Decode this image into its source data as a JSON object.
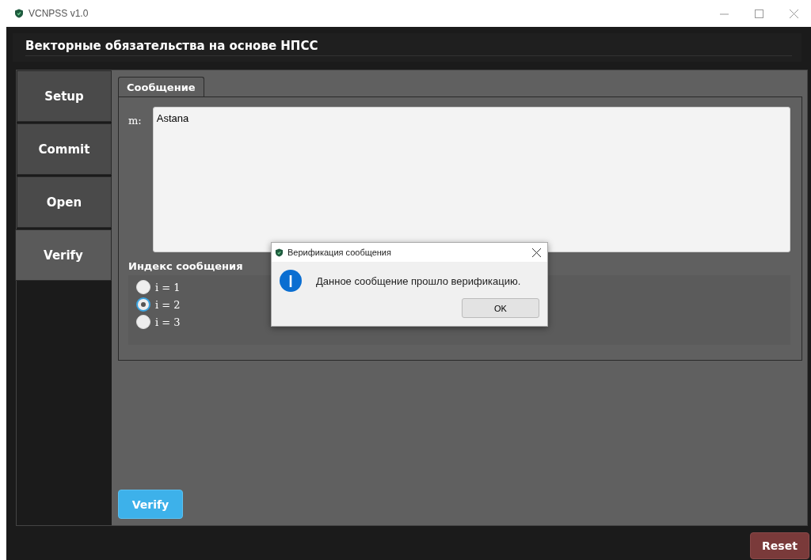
{
  "window": {
    "title": "VCNPSS v1.0"
  },
  "header": {
    "title": "Векторные обязательства на основе НПСС"
  },
  "nav": [
    {
      "label": "Setup",
      "selected": false
    },
    {
      "label": "Commit",
      "selected": false
    },
    {
      "label": "Open",
      "selected": false
    },
    {
      "label": "Verify",
      "selected": true
    }
  ],
  "tabs": [
    {
      "label": "Сообщение",
      "selected": true
    }
  ],
  "message": {
    "label": "m:",
    "value": "Astana"
  },
  "index": {
    "title": "Индекс сообщения",
    "options": [
      {
        "label": "i = 1",
        "selected": false
      },
      {
        "label": "i = 2",
        "selected": true
      },
      {
        "label": "i = 3",
        "selected": false
      }
    ]
  },
  "verify_button": "Verify",
  "reset_button": "Reset",
  "dialog": {
    "title": "Верификация сообщения",
    "message": "Данное сообщение прошло верификацию.",
    "button": "OK"
  }
}
